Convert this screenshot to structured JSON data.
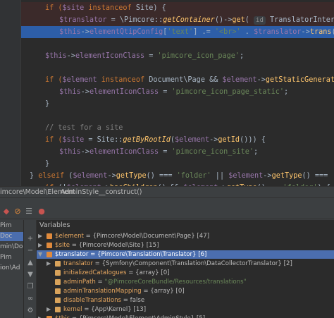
{
  "code": {
    "lines": [
      {
        "kind": "error",
        "segments": [
          [
            "kw",
            "if ("
          ],
          [
            "var",
            "$site "
          ],
          [
            "kw",
            "instanceof "
          ],
          [
            "plain",
            "Site) {"
          ]
        ]
      },
      {
        "kind": "error",
        "segments": [
          [
            "var",
            "$translator"
          ],
          [
            "plain",
            " = \\Pimcore::"
          ],
          [
            "fni",
            "getContainer"
          ],
          [
            "plain",
            "()->"
          ],
          [
            "fn",
            "get"
          ],
          [
            "plain",
            "( "
          ],
          [
            "hint",
            "id"
          ],
          [
            "plain",
            " TranslatorInterface::"
          ],
          [
            "kw",
            "class"
          ],
          [
            "plain",
            ");"
          ]
        ]
      },
      {
        "kind": "exec",
        "segments": [
          [
            "var",
            "$this"
          ],
          [
            "plain",
            "->"
          ],
          [
            "var",
            "elementQtipConfig"
          ],
          [
            "plain",
            "["
          ],
          [
            "str",
            "'text'"
          ],
          [
            "plain",
            "] .= "
          ],
          [
            "str",
            "'<br>'"
          ],
          [
            "plain",
            " . "
          ],
          [
            "var",
            "$translator"
          ],
          [
            "plain",
            "->"
          ],
          [
            "fn",
            "trans"
          ],
          [
            "plain",
            "( "
          ],
          [
            "hint",
            "id:"
          ],
          [
            "plain",
            " "
          ],
          [
            "str",
            "'site_id'"
          ],
          [
            "plain",
            ","
          ]
        ]
      },
      {
        "kind": "blank",
        "segments": []
      },
      {
        "kind": "normal",
        "segments": [
          [
            "var",
            "$this"
          ],
          [
            "plain",
            "->"
          ],
          [
            "var",
            "elementIconClass"
          ],
          [
            "plain",
            " = "
          ],
          [
            "str",
            "'pimcore_icon_page'"
          ],
          [
            "plain",
            ";"
          ]
        ]
      },
      {
        "kind": "blank",
        "segments": []
      },
      {
        "kind": "normal",
        "segments": [
          [
            "kw",
            "if ("
          ],
          [
            "var",
            "$element "
          ],
          [
            "kw",
            "instanceof "
          ],
          [
            "plain",
            "Document\\Page && "
          ],
          [
            "var",
            "$element"
          ],
          [
            "plain",
            "->"
          ],
          [
            "fn",
            "getStaticGeneratorEnabled"
          ],
          [
            "plain",
            "()) {"
          ]
        ]
      },
      {
        "kind": "normal",
        "segments": [
          [
            "var",
            "$this"
          ],
          [
            "plain",
            "->"
          ],
          [
            "var",
            "elementIconClass"
          ],
          [
            "plain",
            " = "
          ],
          [
            "str",
            "'pimcore_icon_page_static'"
          ],
          [
            "plain",
            ";"
          ]
        ]
      },
      {
        "kind": "normal",
        "segments": [
          [
            "plain",
            "}"
          ]
        ]
      },
      {
        "kind": "blank",
        "segments": []
      },
      {
        "kind": "normal",
        "segments": [
          [
            "cmt",
            "// test for a site"
          ]
        ]
      },
      {
        "kind": "normal",
        "segments": [
          [
            "kw",
            "if ("
          ],
          [
            "var",
            "$site"
          ],
          [
            "plain",
            " = Site::"
          ],
          [
            "fni",
            "getByRootId"
          ],
          [
            "plain",
            "("
          ],
          [
            "var",
            "$element"
          ],
          [
            "plain",
            "->"
          ],
          [
            "fn",
            "getId"
          ],
          [
            "plain",
            "())) {"
          ]
        ]
      },
      {
        "kind": "normal",
        "segments": [
          [
            "var",
            "$this"
          ],
          [
            "plain",
            "->"
          ],
          [
            "var",
            "elementIconClass"
          ],
          [
            "plain",
            " = "
          ],
          [
            "str",
            "'pimcore_icon_site'"
          ],
          [
            "plain",
            ";"
          ]
        ]
      },
      {
        "kind": "normal",
        "segments": [
          [
            "plain",
            "}"
          ]
        ]
      },
      {
        "kind": "normal",
        "segments": [
          [
            "plain",
            "} "
          ],
          [
            "kw",
            "elseif "
          ],
          [
            "plain",
            "("
          ],
          [
            "var",
            "$element"
          ],
          [
            "plain",
            "->"
          ],
          [
            "fn",
            "getType"
          ],
          [
            "plain",
            "() === "
          ],
          [
            "str",
            "'folder'"
          ],
          [
            "plain",
            " || "
          ],
          [
            "var",
            "$element"
          ],
          [
            "plain",
            "->"
          ],
          [
            "fn",
            "getType"
          ],
          [
            "plain",
            "() === "
          ],
          [
            "str",
            "'link'"
          ],
          [
            "plain",
            " || "
          ],
          [
            "var",
            "$eleme"
          ]
        ]
      },
      {
        "kind": "normal",
        "segments": [
          [
            "kw",
            "if "
          ],
          [
            "plain",
            "(!"
          ],
          [
            "var",
            "$element"
          ],
          [
            "plain",
            "->"
          ],
          [
            "fn",
            "hasChildren"
          ],
          [
            "plain",
            "() && "
          ],
          [
            "var",
            "$element"
          ],
          [
            "plain",
            "->"
          ],
          [
            "fn",
            "getType"
          ],
          [
            "plain",
            "() == "
          ],
          [
            "str",
            "'folder'"
          ],
          [
            "plain",
            ") {"
          ]
        ]
      },
      {
        "kind": "normal",
        "segments": [
          [
            "var",
            "$this"
          ],
          [
            "plain",
            "->"
          ],
          [
            "var",
            "elementIconClass"
          ],
          [
            "plain",
            " = "
          ],
          [
            "str",
            "'pimcore_icon_folder'"
          ],
          [
            "plain",
            ";"
          ]
        ]
      },
      {
        "kind": "normal",
        "segments": [
          [
            "plain",
            "}"
          ]
        ]
      }
    ]
  },
  "breadcrumb": {
    "items": [
      "imcore\\Model\\Element",
      "AdminStyle",
      "__construct()"
    ]
  },
  "debugger": {
    "variables_title": "Variables",
    "frames": [
      "Pim",
      "Doc",
      "min\\Do",
      "Pim",
      "ion\\Ad"
    ],
    "variables": [
      {
        "name": "$element",
        "value": "= {Pimcore\\Model\\Document\\Page} [47]",
        "level": 0,
        "expanded": false,
        "selected": false
      },
      {
        "name": "$site",
        "value": "= {Pimcore\\Model\\Site} [15]",
        "level": 0,
        "expanded": false,
        "selected": false
      },
      {
        "name": "$translator",
        "value": "= {Pimcore\\Translation\\Translator} [6]",
        "level": 0,
        "expanded": true,
        "selected": true
      },
      {
        "name": "translator",
        "value": "= {Symfony\\Component\\Translation\\DataCollectorTranslator} [2]",
        "level": 1,
        "expanded": false,
        "selected": false
      },
      {
        "name": "initializedCatalogues",
        "value": "= {array} [0]",
        "level": 1,
        "expanded": null,
        "selected": false
      },
      {
        "name": "adminPath",
        "value": "= ",
        "strval": "\"@PimcoreCoreBundle/Resources/translations\"",
        "level": 1,
        "expanded": null,
        "selected": false
      },
      {
        "name": "adminTranslationMapping",
        "value": "= {array} [0]",
        "level": 1,
        "expanded": null,
        "selected": false
      },
      {
        "name": "disableTranslations",
        "value": "= false",
        "level": 1,
        "expanded": null,
        "selected": false
      },
      {
        "name": "kernel",
        "value": "= {App\\Kernel} [13]",
        "level": 1,
        "expanded": false,
        "selected": false
      },
      {
        "name": "$this",
        "value": "= {Pimcore\\Model\\Element\\AdminStyle} [5]",
        "level": 0,
        "expanded": false,
        "selected": false
      }
    ]
  },
  "colors": {
    "editor_bg": "#2b2b2b",
    "keyword": "#cc7832",
    "variable": "#9876aa",
    "string": "#6a8759",
    "function": "#ffc66d",
    "comment": "#808080",
    "exec_line": "#2d5ea8",
    "selection": "#4b6eaf"
  },
  "icons": {
    "frames_restore": "stop-icon",
    "mute": "mute-icon",
    "settings": "settings-icon",
    "add_watch": "plus-icon",
    "remove_watch": "minus-icon",
    "up": "up-icon",
    "down": "down-icon",
    "copy": "copy-icon",
    "glasses": "glasses-icon"
  }
}
